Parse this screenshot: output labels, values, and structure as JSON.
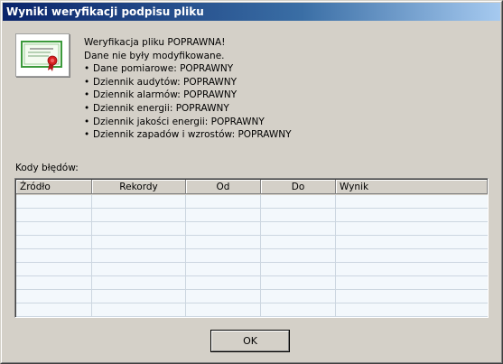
{
  "window": {
    "title": "Wyniki weryfikacji podpisu pliku"
  },
  "icon": {
    "name": "certificate-icon"
  },
  "message": {
    "heading": "Weryfikacja pliku POPRAWNA!",
    "subheading": "Dane nie były modyfikowane.",
    "items": [
      "Dane pomiarowe: POPRAWNY",
      "Dziennik audytów: POPRAWNY",
      "Dziennik alarmów: POPRAWNY",
      "Dziennik energii: POPRAWNY",
      "Dziennik jakości energii: POPRAWNY",
      "Dziennik zapadów i wzrostów: POPRAWNY"
    ]
  },
  "errors": {
    "label": "Kody błędów:",
    "columns": [
      "Źródło",
      "Rekordy",
      "Od",
      "Do",
      "Wynik"
    ],
    "rows": []
  },
  "buttons": {
    "ok": "OK"
  }
}
